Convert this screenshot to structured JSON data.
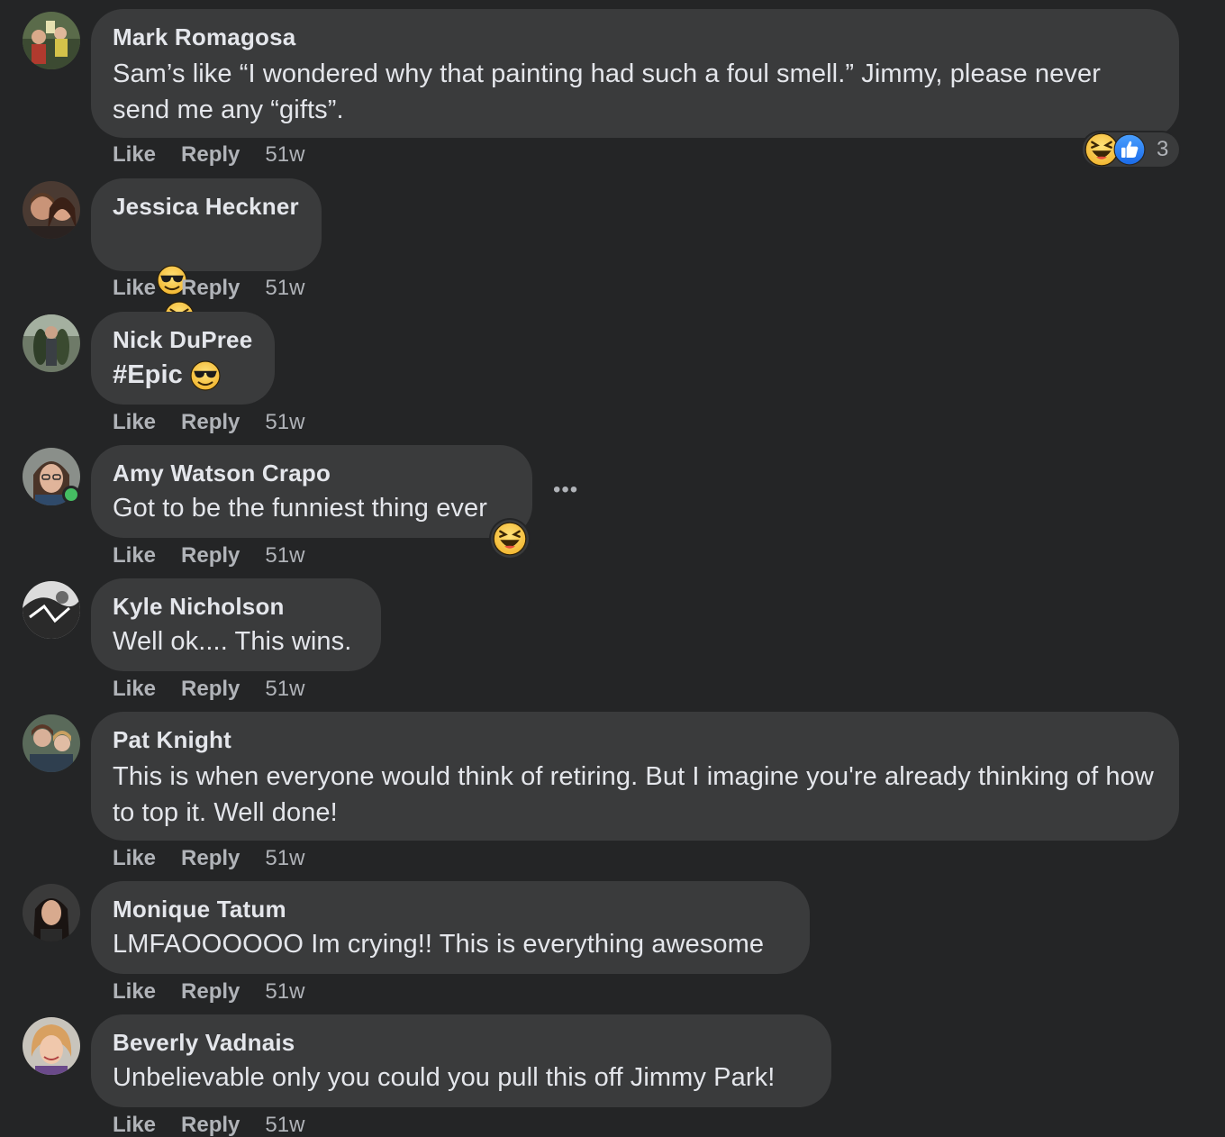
{
  "actions": {
    "like_label": "Like",
    "reply_label": "Reply"
  },
  "comments": [
    {
      "author": "Mark Romagosa",
      "text": "Sam’s like “I wondered why that painting had such a foul smell.” Jimmy, please never send me any “gifts”.",
      "time": "51w",
      "reaction_count": "3",
      "reactions": [
        "laughing-emoji",
        "like-thumb"
      ]
    },
    {
      "author": "Jessica Heckner",
      "text": "",
      "emojis": [
        "sunglasses-emoji",
        "squinting-tongue-emoji"
      ],
      "time": "51w"
    },
    {
      "author": "Nick DuPree",
      "text": "#Epic",
      "emojis": [
        "sunglasses-emoji"
      ],
      "time": "51w"
    },
    {
      "author": "Amy Watson Crapo",
      "text": "Got to be the funniest thing ever",
      "time": "51w",
      "online": true,
      "reactions": [
        "laughing-emoji"
      ],
      "more_icon": "more-dots-icon"
    },
    {
      "author": "Kyle Nicholson",
      "text": "Well ok.... This wins.",
      "time": "51w"
    },
    {
      "author": "Pat Knight",
      "text": "This is when everyone would think of retiring. But I imagine you're already thinking of how to top it. Well done!",
      "time": "51w"
    },
    {
      "author": "Monique Tatum",
      "text": "LMFAOOOOOO Im crying!! This is everything awesome",
      "time": "51w"
    },
    {
      "author": "Beverly Vadnais",
      "text": "Unbelievable only you could you pull this off Jimmy Park!",
      "time": "51w"
    }
  ],
  "colors": {
    "background": "#242526",
    "bubble": "#3a3b3c",
    "text_primary": "#e4e6eb",
    "text_secondary": "#b0b3b8",
    "like_blue": "#2078f4",
    "emoji_yellow": "#f7c94b",
    "online_green": "#45bd62"
  }
}
